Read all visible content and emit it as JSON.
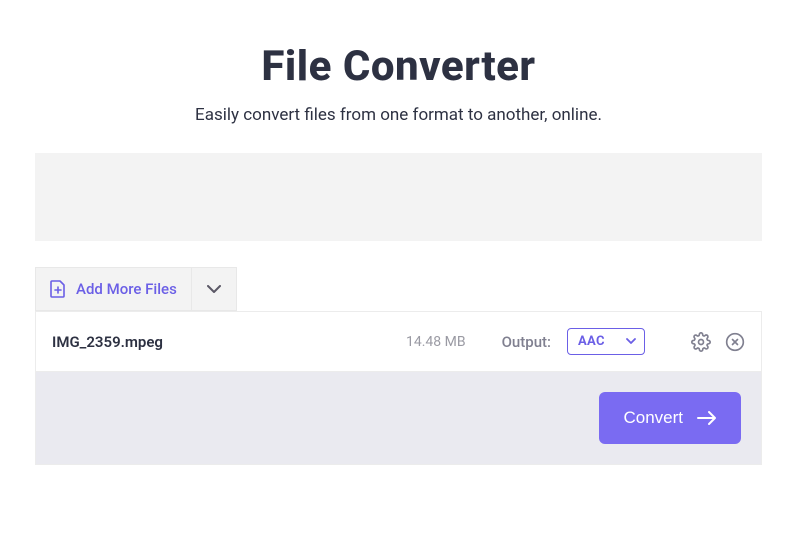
{
  "header": {
    "title": "File Converter",
    "subtitle": "Easily convert files from one format to another, online."
  },
  "toolbar": {
    "add_more_label": "Add More Files"
  },
  "files": [
    {
      "name": "IMG_2359.mpeg",
      "size": "14.48 MB",
      "output_label": "Output:",
      "format": "AAC"
    }
  ],
  "footer": {
    "convert_label": "Convert"
  },
  "colors": {
    "accent": "#7a6bf2",
    "accent_dark": "#6b5fe6"
  }
}
